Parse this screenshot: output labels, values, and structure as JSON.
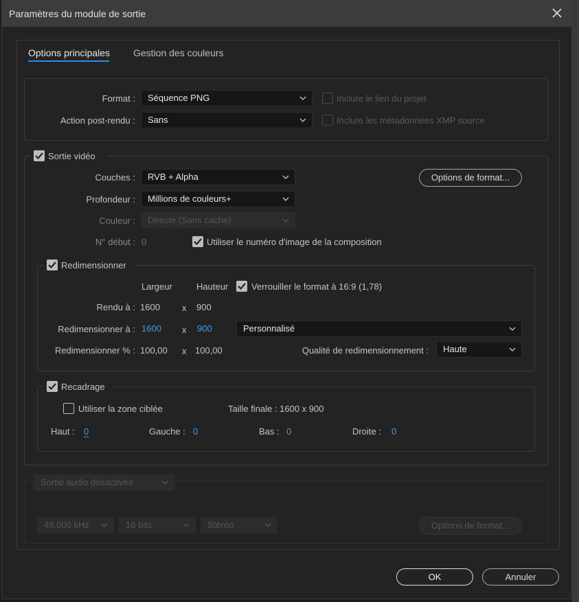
{
  "dialog": {
    "title": "Paramètres du module de sortie"
  },
  "tabs": [
    {
      "label": "Options principales",
      "active": true
    },
    {
      "label": "Gestion des couleurs",
      "active": false
    }
  ],
  "top": {
    "format_label": "Format :",
    "format_value": "Séquence PNG",
    "post_render_label": "Action post-rendu :",
    "post_render_value": "Sans",
    "include_link_label": "Inclure le lien du projet",
    "include_xmp_label": "Inclure les métadonnées XMP source"
  },
  "video": {
    "section_label": "Sortie vidéo",
    "channels_label": "Couches :",
    "channels_value": "RVB + Alpha",
    "depth_label": "Profondeur :",
    "depth_value": "Millions de couleurs+",
    "color_label": "Couleur :",
    "color_value": "Directe (Sans cache)",
    "start_label": "N° début :",
    "start_value": "0",
    "use_comp_frame_label": "Utiliser le numéro d'image de la composition",
    "format_options_btn": "Options de format..."
  },
  "resize": {
    "section_label": "Redimensionner",
    "width_header": "Largeur",
    "height_header": "Hauteur",
    "lock_label": "Verrouiller le format à 16:9 (1,78)",
    "render_label": "Rendu à :",
    "render_w": "1600",
    "render_h": "900",
    "resize_to_label": "Redimensionner à :",
    "resize_w": "1600",
    "resize_h": "900",
    "preset_value": "Personnalisé",
    "percent_label": "Redimensionner % :",
    "percent_w": "100,00",
    "percent_h": "100,00",
    "x": "x",
    "quality_label": "Qualité de redimensionnement :",
    "quality_value": "Haute"
  },
  "crop": {
    "section_label": "Recadrage",
    "use_roi_label": "Utiliser la zone ciblée",
    "final_size_label": "Taille finale : 1600 x 900",
    "top_label": "Haut :",
    "top_value": "0",
    "left_label": "Gauche :",
    "left_value": "0",
    "bottom_label": "Bas :",
    "bottom_value": "0",
    "right_label": "Droite :",
    "right_value": "0"
  },
  "audio": {
    "output_value": "Sortie audio désactivée",
    "rate_value": "48,000 kHz",
    "bits_value": "16 bits",
    "channels_value": "Stéréo",
    "format_options_btn": "Options de format..."
  },
  "footer": {
    "ok_label": "OK",
    "cancel_label": "Annuler"
  },
  "colors": {
    "accent": "#2d8ceb",
    "link_value": "#3d9be9",
    "background": "#232323"
  }
}
